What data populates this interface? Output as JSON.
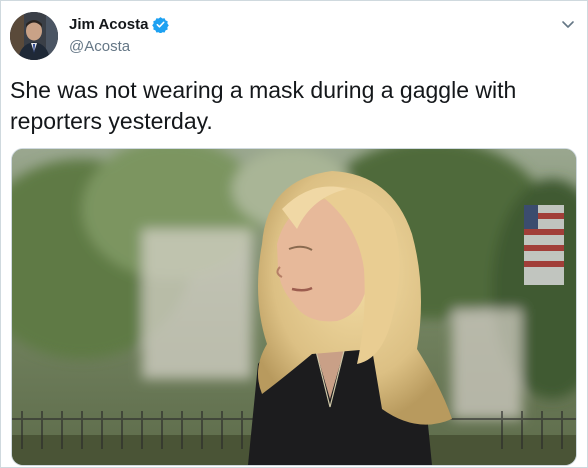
{
  "tweet": {
    "author_name": "Jim Acosta",
    "author_handle": "@Acosta",
    "text": "She was not wearing a mask during a gaggle with reporters yesterday.",
    "verified": true
  },
  "icons": {
    "verified": "verified-badge-icon",
    "menu": "chevron-down-icon"
  },
  "colors": {
    "verified_blue": "#1da1f2",
    "name": "#14171a",
    "handle": "#657786",
    "border": "#cfd9de"
  }
}
